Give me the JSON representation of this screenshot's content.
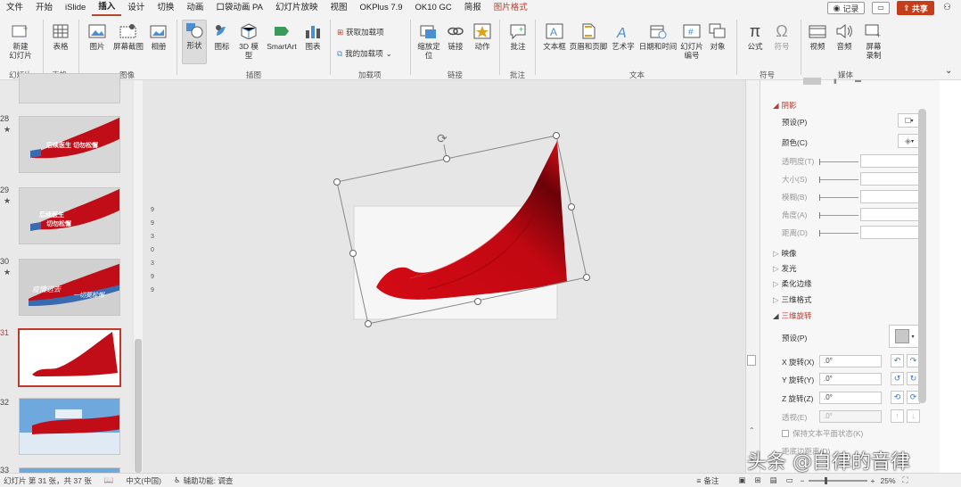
{
  "menu": {
    "tabs": [
      "文件",
      "开始",
      "iSlide",
      "插入",
      "设计",
      "切换",
      "动画",
      "口袋动画 PA",
      "幻灯片放映",
      "视图",
      "OKPlus 7.9",
      "OK10 GC",
      "简报",
      "图片格式"
    ],
    "record": "记录",
    "share": "共享"
  },
  "ribbon": {
    "new_slide": "新建\n幻灯片",
    "table": "表格",
    "picture": "图片",
    "screenshot": "屏幕截图",
    "album": "相册",
    "shapes": "形状",
    "icons": "图标",
    "model3d": "3D 模\n型",
    "smartart": "SmartArt",
    "chart": "图表",
    "get_addins": "获取加载项",
    "my_addins": "我的加载项",
    "zoom": "缩放定\n位",
    "link": "链接",
    "action": "动作",
    "comment": "批注",
    "textbox": "文本框",
    "header_footer": "页眉和页脚",
    "wordart": "艺术字",
    "datetime": "日期和时间",
    "slide_number": "幻灯片\n编号",
    "object": "对象",
    "equation": "公式",
    "symbol": "符号",
    "video": "视频",
    "audio": "音频",
    "screen_record": "屏幕\n录制",
    "groups": {
      "slides": "幻灯片",
      "tables": "表格",
      "images": "图像",
      "illustrations": "插图",
      "addins": "加载项",
      "links": "链接",
      "comments": "批注",
      "text": "文本",
      "symbols": "符号",
      "media": "媒体"
    }
  },
  "thumbnails": [
    {
      "num": "28",
      "star": "★"
    },
    {
      "num": "29",
      "star": "★"
    },
    {
      "num": "30",
      "star": "★"
    },
    {
      "num": "31",
      "star": ""
    },
    {
      "num": "32",
      "star": ""
    },
    {
      "num": "33",
      "star": ""
    }
  ],
  "thumb_text": {
    "t28": "后续医生 切勿松懈",
    "t29": "后续医生\n切勿松懈",
    "t30": "疫情远去\n一切莫松懈"
  },
  "ruler_digits": [
    "9",
    "9",
    "3",
    "0",
    "3",
    "9",
    "9"
  ],
  "panel": {
    "shadow": "阴影",
    "preset": "预设(P)",
    "color": "颜色(C)",
    "transparency": "透明度(T)",
    "size": "大小(S)",
    "blur": "模糊(B)",
    "angle": "角度(A)",
    "distance": "距离(D)",
    "reflection": "映像",
    "glow": "发光",
    "soft_edges": "柔化边缘",
    "format3d": "三维格式",
    "rotation3d": "三维旋转",
    "preset2": "预设(P)",
    "x_rotation": "X 旋转(X)",
    "y_rotation": "Y 旋转(Y)",
    "z_rotation": "Z 旋转(Z)",
    "perspective": "透视(E)",
    "x_value": ".0°",
    "y_value": ".0°",
    "z_value": ".0°",
    "persp_value": ".0°",
    "keep_flat": "保持文本平面状态(K)",
    "distance_ground": "距底边距离(D)"
  },
  "status": {
    "slide_info": "幻灯片 第 31 张，共 37 张",
    "language": "中文(中国)",
    "accessibility": "辅助功能: 调查",
    "notes": "备注",
    "zoom": "25%"
  },
  "watermark": "头条 @自律的音律",
  "colors": {
    "accent": "#c0392b",
    "share": "#c43e1c",
    "flag": "#d40a14"
  }
}
